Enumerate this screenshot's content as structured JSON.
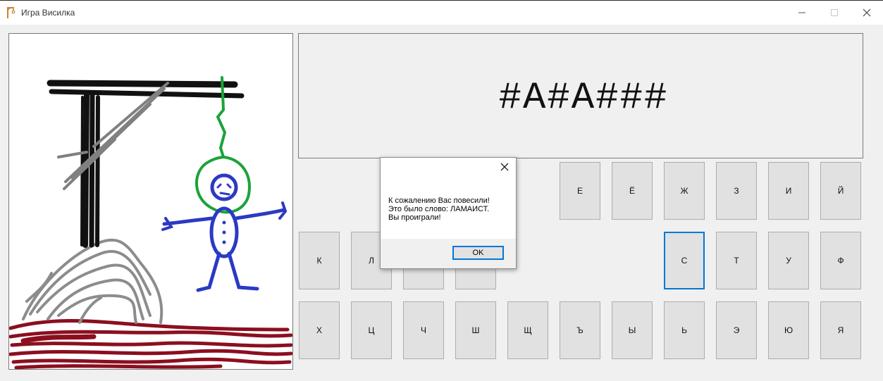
{
  "window": {
    "title": "Игра Висилка",
    "minimize_icon": "minimize-icon",
    "maximize_icon": "maximize-icon",
    "close_icon": "close-icon"
  },
  "word": {
    "display": "#A#A###"
  },
  "drawing": {
    "colors": {
      "gallows": "#111111",
      "rope": "#1aa33a",
      "figure": "#2c39c4",
      "mound": "#8c8c8c",
      "ground": "#8b0f1f"
    },
    "stage": "hanged"
  },
  "keyboard": {
    "row1": [
      "Е",
      "Ё",
      "Ж",
      "З",
      "И",
      "Й"
    ],
    "row2_left": [
      "К",
      "Л",
      "",
      ""
    ],
    "row2_right": [
      "С",
      "Т",
      "У",
      "Ф"
    ],
    "row3": [
      "Х",
      "Ц",
      "Ч",
      "Ш",
      "Щ",
      "Ъ",
      "Ы",
      "Ь",
      "Э",
      "Ю",
      "Я"
    ],
    "focused_key": "С"
  },
  "dialog": {
    "line1": "К сожалению Вас повесили!",
    "line2": "Это было слово: ЛАМАИСТ.",
    "line3": "Вы проиграли!",
    "ok_label": "OK",
    "close_icon": "close-icon"
  }
}
